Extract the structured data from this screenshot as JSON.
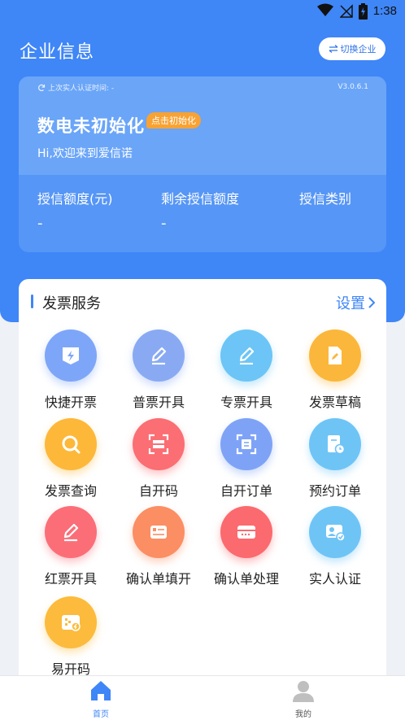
{
  "status_bar": {
    "time": "1:38"
  },
  "header": {
    "title": "企业信息",
    "switch_label": "切换企业"
  },
  "company_card": {
    "last_auth": "上次实人认证时间: -",
    "version": "V3.0.6.1",
    "status": "数电未初始化",
    "init_badge": "点击初始化",
    "welcome": "Hi,欢迎来到爱信诺",
    "stats": [
      {
        "label": "授信额度(元)",
        "value": "-"
      },
      {
        "label": "剩余授信额度",
        "value": "-"
      },
      {
        "label": "授信类别",
        "value": ""
      }
    ]
  },
  "invoice_services": {
    "title": "发票服务",
    "settings_label": "设置",
    "items": [
      {
        "label": "快捷开票",
        "icon": "quick-invoice-icon",
        "color": "#7ea6f8"
      },
      {
        "label": "普票开具",
        "icon": "pen-icon",
        "color": "#89aaf3"
      },
      {
        "label": "专票开具",
        "icon": "pen-icon",
        "color": "#6cc5f6"
      },
      {
        "label": "发票草稿",
        "icon": "draft-doc-icon",
        "color": "#fbb73b"
      },
      {
        "label": "发票查询",
        "icon": "magnifier-icon",
        "color": "#fdb83a"
      },
      {
        "label": "自开码",
        "icon": "scan-icon",
        "color": "#fb6e73"
      },
      {
        "label": "自开订单",
        "icon": "scan-doc-icon",
        "color": "#7ea3f6"
      },
      {
        "label": "预约订单",
        "icon": "schedule-doc-icon",
        "color": "#6fc4f6"
      },
      {
        "label": "红票开具",
        "icon": "pen-icon",
        "color": "#fb6e78"
      },
      {
        "label": "确认单填开",
        "icon": "form-icon",
        "color": "#fb8e63"
      },
      {
        "label": "确认单处理",
        "icon": "card-icon",
        "color": "#fb6a6e"
      },
      {
        "label": "实人认证",
        "icon": "id-verify-icon",
        "color": "#6fc4f6"
      },
      {
        "label": "易开码",
        "icon": "easy-code-icon",
        "color": "#fcbb3c"
      }
    ]
  },
  "tabbar": {
    "home": "首页",
    "mine": "我的",
    "active_color": "#3f86f7"
  }
}
